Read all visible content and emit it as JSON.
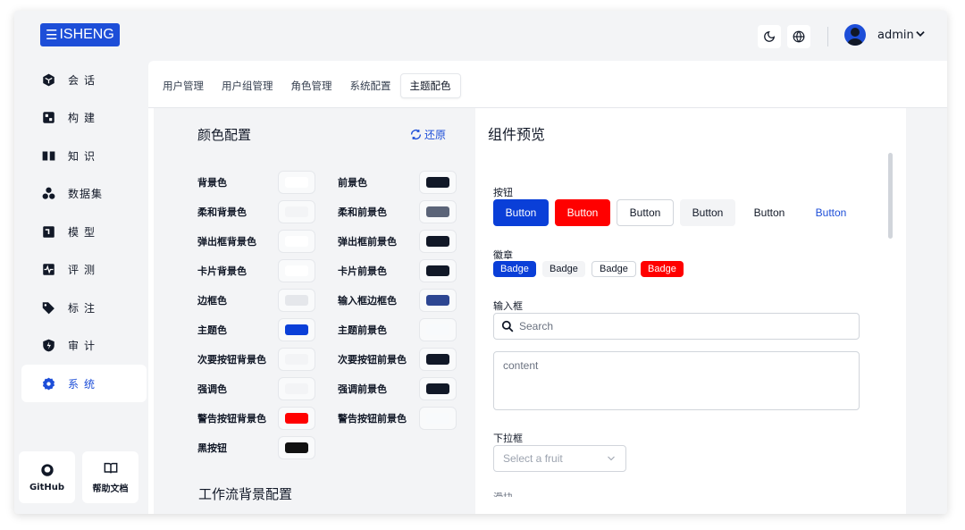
{
  "app": {
    "logo_text": "ISHENG",
    "user_name": "admin"
  },
  "sidebar": {
    "items": [
      {
        "label": "会话",
        "icon": "cube-icon"
      },
      {
        "label": "构建",
        "icon": "build-icon"
      },
      {
        "label": "知识",
        "icon": "book-open-icon"
      },
      {
        "label": "数据集",
        "icon": "shapes-icon"
      },
      {
        "label": "模型",
        "icon": "model-icon"
      },
      {
        "label": "评测",
        "icon": "activity-icon"
      },
      {
        "label": "标注",
        "icon": "tag-icon"
      },
      {
        "label": "审计",
        "icon": "shield-icon"
      },
      {
        "label": "系统",
        "icon": "gear-icon",
        "active": true
      }
    ],
    "bottom": [
      {
        "label": "GitHub",
        "icon": "github-icon"
      },
      {
        "label": "帮助文档",
        "icon": "book-icon"
      }
    ]
  },
  "tabs": [
    "用户管理",
    "用户组管理",
    "角色管理",
    "系统配置",
    "主题配色"
  ],
  "active_tab": "主题配色",
  "color_config": {
    "title": "颜色配置",
    "reset_label": "还原",
    "left": [
      {
        "label": "背景色",
        "color": "#ffffff"
      },
      {
        "label": "柔和背景色",
        "color": "#f3f4f6"
      },
      {
        "label": "弹出框背景色",
        "color": "#ffffff"
      },
      {
        "label": "卡片背景色",
        "color": "#ffffff"
      },
      {
        "label": "边框色",
        "color": "#e5e7eb"
      },
      {
        "label": "主题色",
        "color": "#0a3fd8"
      },
      {
        "label": "次要按钮背景色",
        "color": "#f3f4f6"
      },
      {
        "label": "强调色",
        "color": "#f3f4f6"
      },
      {
        "label": "警告按钮背景色",
        "color": "#ff0000"
      },
      {
        "label": "黑按钮",
        "color": "#111111"
      }
    ],
    "right": [
      {
        "label": "前景色",
        "color": "#111827"
      },
      {
        "label": "柔和前景色",
        "color": "#5b6478"
      },
      {
        "label": "弹出框前景色",
        "color": "#111827"
      },
      {
        "label": "卡片前景色",
        "color": "#111827"
      },
      {
        "label": "输入框边框色",
        "color": "#2d4692"
      },
      {
        "label": "主题前景色",
        "color": "#f8fafc"
      },
      {
        "label": "次要按钮前景色",
        "color": "#111827"
      },
      {
        "label": "强调前景色",
        "color": "#111827"
      },
      {
        "label": "警告按钮前景色",
        "color": "#f8fafc"
      }
    ],
    "workflow_title": "工作流背景配置"
  },
  "preview": {
    "title": "组件预览",
    "buttons_label": "按钮",
    "buttons": [
      "Button",
      "Button",
      "Button",
      "Button",
      "Button",
      "Button"
    ],
    "badges_label": "徽章",
    "badges": [
      "Badge",
      "Badge",
      "Badge",
      "Badge"
    ],
    "input_label": "输入框",
    "search_placeholder": "Search",
    "textarea_value": "content",
    "select_label": "下拉框",
    "select_placeholder": "Select a fruit",
    "next_label": "滑块"
  },
  "colors": {
    "primary": "#0a3fd8",
    "destructive": "#ff0000"
  }
}
